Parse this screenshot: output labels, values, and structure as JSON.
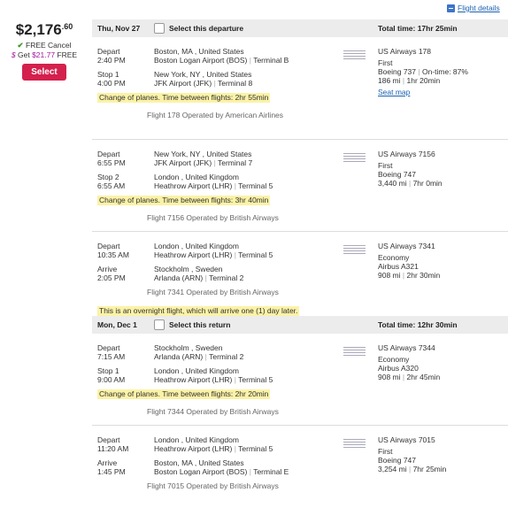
{
  "top_link": "Flight details",
  "price": {
    "main": "$2,176",
    "cents": ".60",
    "cancel": "FREE Cancel",
    "get_prefix": "Get ",
    "get_amount": "$21.77",
    "get_suffix": " FREE",
    "select": "Select"
  },
  "sections": [
    {
      "date": "Thu, Nov 27",
      "select_label": "Select this departure",
      "total": "Total time: 17hr 25min",
      "segments": [
        {
          "l1a": "Depart",
          "l1b": "2:40 PM",
          "c1a": "Boston, MA , United States",
          "c1b": "Boston Logan Airport (BOS)",
          "c1t": "Terminal B",
          "l2a": "Stop 1",
          "l2b": "4:00 PM",
          "c2a": "New York, NY , United States",
          "c2b": "JFK Airport (JFK)",
          "c2t": "Terminal 8",
          "airline": "US Airways 178",
          "cabin": "First",
          "plane": "Boeing 737",
          "ontime": "On-time: 87%",
          "dist": "186 mi",
          "dur": "1hr 20min",
          "seatmap": "Seat map",
          "warn": "Change of planes. Time between flights: 2hr 55min",
          "op": "Flight 178 Operated by American Airlines"
        },
        {
          "l1a": "Depart",
          "l1b": "6:55 PM",
          "c1a": "New York, NY , United States",
          "c1b": "JFK Airport (JFK)",
          "c1t": "Terminal 7",
          "l2a": "Stop 2",
          "l2b": "6:55 AM",
          "c2a": "London , United Kingdom",
          "c2b": "Heathrow Airport (LHR)",
          "c2t": "Terminal 5",
          "airline": "US Airways 7156",
          "cabin": "First",
          "plane": "Boeing 747",
          "dist": "3,440 mi",
          "dur": "7hr 0min",
          "warn": "Change of planes. Time between flights: 3hr 40min",
          "op": "Flight 7156 Operated by British Airways"
        },
        {
          "l1a": "Depart",
          "l1b": "10:35 AM",
          "c1a": "London , United Kingdom",
          "c1b": "Heathrow Airport (LHR)",
          "c1t": "Terminal 5",
          "l2a": "Arrive",
          "l2b": "2:05 PM",
          "c2a": "Stockholm , Sweden",
          "c2b": "Arlanda (ARN)",
          "c2t": "Terminal 2",
          "airline": "US Airways 7341",
          "cabin": "Economy",
          "plane": "Airbus A321",
          "dist": "908 mi",
          "dur": "2hr 30min",
          "op": "Flight 7341 Operated by British Airways",
          "warn": "This is an overnight flight, which will arrive one (1) day later."
        }
      ]
    },
    {
      "date": "Mon, Dec 1",
      "select_label": "Select this return",
      "total": "Total time: 12hr 30min",
      "segments": [
        {
          "l1a": "Depart",
          "l1b": "7:15 AM",
          "c1a": "Stockholm , Sweden",
          "c1b": "Arlanda (ARN)",
          "c1t": "Terminal 2",
          "l2a": "Stop 1",
          "l2b": "9:00 AM",
          "c2a": "London , United Kingdom",
          "c2b": "Heathrow Airport (LHR)",
          "c2t": "Terminal 5",
          "airline": "US Airways 7344",
          "cabin": "Economy",
          "plane": "Airbus A320",
          "dist": "908 mi",
          "dur": "2hr 45min",
          "warn": "Change of planes. Time between flights: 2hr 20min",
          "op": "Flight 7344 Operated by British Airways"
        },
        {
          "l1a": "Depart",
          "l1b": "11:20 AM",
          "c1a": "London , United Kingdom",
          "c1b": "Heathrow Airport (LHR)",
          "c1t": "Terminal 5",
          "l2a": "Arrive",
          "l2b": "1:45 PM",
          "c2a": "Boston, MA , United States",
          "c2b": "Boston Logan Airport (BOS)",
          "c2t": "Terminal E",
          "airline": "US Airways 7015",
          "cabin": "First",
          "plane": "Boeing 747",
          "dist": "3,254 mi",
          "dur": "7hr 25min",
          "op": "Flight 7015 Operated by British Airways"
        }
      ]
    }
  ]
}
